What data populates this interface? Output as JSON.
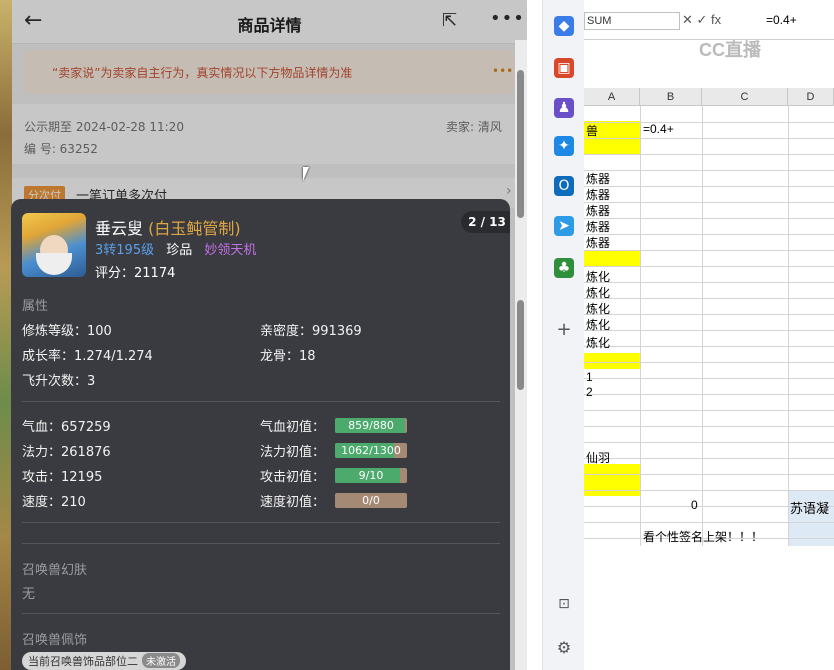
{
  "page": {
    "title": "商品详情",
    "notice": "“卖家说”为卖家自主行为，真实情况以下方物品详情为准",
    "publish_until": "公示期至 2024-02-28 11:20",
    "seller": "卖家: 清风",
    "code": "编 号: 63252",
    "pay_tag": "分次付",
    "pay_label": "一笔订单多次付"
  },
  "pet": {
    "name": "垂云叟",
    "subname": "(白玉鲀管制)",
    "counter": "2 / 13",
    "level": "3转195级",
    "rarity": "珍品",
    "skill": "妙领天机",
    "score": "评分：21174"
  },
  "attributes": {
    "heading": "属性",
    "cultivation": "修炼等级：100",
    "intimacy": "亲密度：991369",
    "growth": "成长率：1.274/1.274",
    "dragon_bone": "龙骨：18",
    "ascension": "飞升次数：3"
  },
  "stats": {
    "hp": "气血：657259",
    "mp": "法力：261876",
    "attack": "攻击：12195",
    "speed": "速度：210",
    "hp_init_label": "气血初值：",
    "mp_init_label": "法力初值：",
    "atk_init_label": "攻击初值：",
    "spd_init_label": "速度初值：",
    "hp_init": "859/880",
    "mp_init": "1062/1300",
    "atk_init": "9/10",
    "spd_init": "0/0",
    "hp_init_frac": 0.976,
    "mp_init_frac": 0.817,
    "atk_init_frac": 0.9,
    "spd_init_frac": 0.0
  },
  "skin": {
    "heading": "召唤兽幻肤",
    "value": "无"
  },
  "decoration": {
    "heading": "召唤兽佩饰",
    "chip": "当前召唤兽饰品部位二",
    "chip_extra": "未激活"
  },
  "sheet": {
    "namebox": "SUM",
    "formula": "=0.4+",
    "watermark": "CC直播",
    "columns": [
      "A",
      "B",
      "C",
      "D"
    ],
    "cell_a2": "兽",
    "cell_b2": "=0.4+",
    "rows_a": [
      "炼器",
      "炼器",
      "炼器",
      "炼器",
      "炼器"
    ],
    "rows_b": [
      "炼化",
      "炼化",
      "炼化",
      "炼化",
      "炼化"
    ],
    "num1": "1",
    "num2": "2",
    "xianyu": "仙羽",
    "zero": "0",
    "d_text": "苏语凝",
    "signature": "看个性签名上架！！！"
  },
  "colors": {
    "accent_yellow": "#ffff00",
    "level_blue": "#5aa0ea",
    "skill_purple": "#c470e8",
    "bar_green": "#4caa6d"
  }
}
